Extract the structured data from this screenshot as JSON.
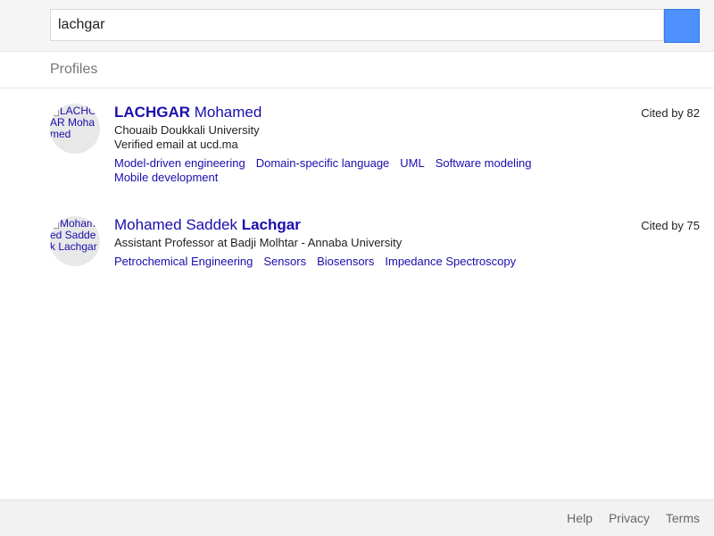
{
  "search": {
    "value": "lachgar",
    "button_icon": "search-icon"
  },
  "section": {
    "title": "Profiles"
  },
  "profiles": [
    {
      "avatar_alt": "LACHGAR Mohamed",
      "name_bold": "LACHGAR",
      "name_regular": " Mohamed",
      "affiliation": "Chouaib Doukkali University",
      "email": "Verified email at ucd.ma",
      "interests": [
        "Model-driven engineering",
        "Domain-specific language",
        "UML",
        "Software modeling",
        "Mobile development"
      ],
      "cited": "Cited by 82"
    },
    {
      "avatar_alt": "Mohamed Saddek Lachgar",
      "name_regular": "Mohamed Saddek ",
      "name_bold": "Lachgar",
      "affiliation": "Assistant Professor at Badji Molhtar - Annaba University",
      "interests": [
        "Petrochemical Engineering",
        "Sensors",
        "Biosensors",
        "Impedance Spectroscopy"
      ],
      "cited": "Cited by 75"
    }
  ],
  "footer": {
    "links": [
      "Help",
      "Privacy",
      "Terms"
    ]
  },
  "colors": {
    "link": "#1a0dab",
    "accent": "#4d90fe"
  }
}
